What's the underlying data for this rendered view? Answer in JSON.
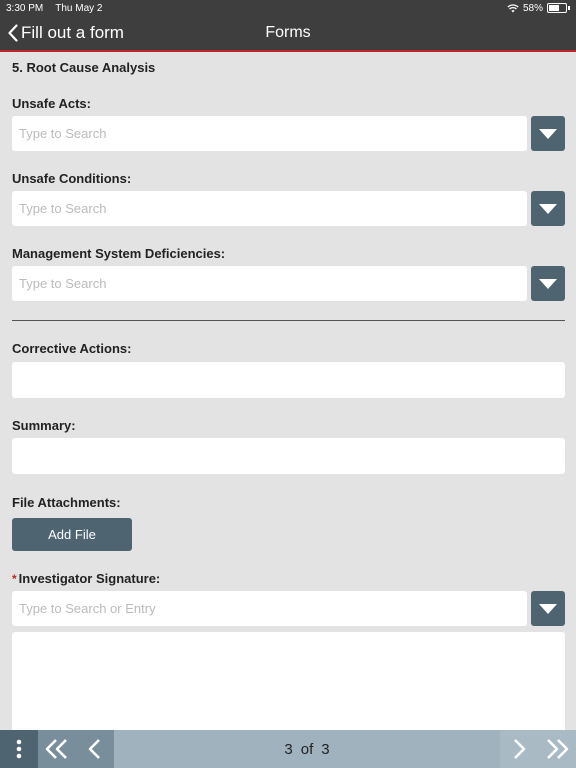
{
  "status_bar": {
    "time": "3:30 PM",
    "date": "Thu May 2",
    "battery": "58%"
  },
  "nav": {
    "back_label": "Fill out a form",
    "title": "Forms"
  },
  "section_title": "5. Root Cause Analysis",
  "fields": {
    "unsafe_acts": {
      "label": "Unsafe Acts:",
      "placeholder": "Type to Search",
      "value": ""
    },
    "unsafe_conditions": {
      "label": "Unsafe Conditions:",
      "placeholder": "Type to Search",
      "value": ""
    },
    "management_deficiencies": {
      "label": "Management System Deficiencies:",
      "placeholder": "Type to Search",
      "value": ""
    },
    "corrective_actions": {
      "label": "Corrective Actions:",
      "value": ""
    },
    "summary": {
      "label": "Summary:",
      "value": ""
    },
    "file_attachments": {
      "label": "File Attachments:",
      "button_label": "Add File"
    },
    "investigator_signature": {
      "required_mark": "*",
      "label": "Investigator Signature:",
      "placeholder": "Type to Search or Entry",
      "value": ""
    }
  },
  "pager": {
    "current": "3",
    "of_label": "of",
    "total": "3"
  },
  "colors": {
    "accent_red": "#c0262c",
    "button_slate": "#4e6470",
    "bar_dark": "#3e3e3e",
    "pager_bg": "#9fb2be",
    "page_bg": "#e3e3e3"
  },
  "icons": {
    "wifi": "wifi-icon",
    "battery": "battery-icon",
    "back": "chevron-left-icon",
    "dropdown": "caret-down-icon",
    "menu": "more-vertical-icon",
    "first": "double-chevron-left-icon",
    "prev": "chevron-left-icon",
    "next": "chevron-right-icon",
    "last": "double-chevron-right-icon"
  }
}
